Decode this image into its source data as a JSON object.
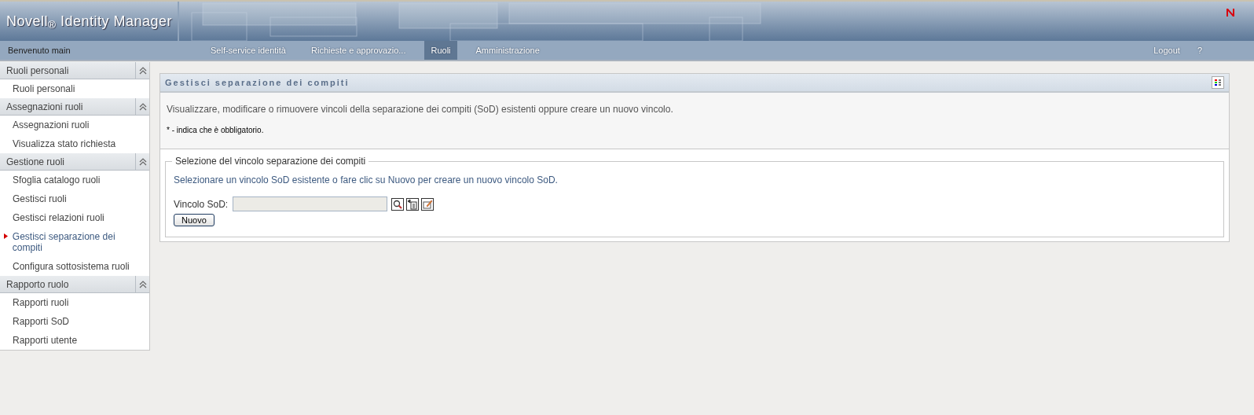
{
  "header": {
    "title": "Novell$_{®}$ Identity Manager"
  },
  "nav": {
    "welcome": "Benvenuto main",
    "tabs": [
      {
        "label": "Self-service identità",
        "selected": false
      },
      {
        "label": "Richieste e approvazio...",
        "selected": false
      },
      {
        "label": "Ruoli",
        "selected": true
      },
      {
        "label": "Amministrazione",
        "selected": false
      }
    ],
    "links": [
      "Logout",
      "?"
    ]
  },
  "sidebar": {
    "sections": [
      {
        "title": "Ruoli personali",
        "expanded": true,
        "items": [
          {
            "label": "Ruoli personali",
            "selected": false
          }
        ]
      },
      {
        "title": "Assegnazioni ruoli",
        "expanded": true,
        "items": [
          {
            "label": "Assegnazioni ruoli",
            "selected": false
          },
          {
            "label": "Visualizza stato richiesta",
            "selected": false
          }
        ]
      },
      {
        "title": "Gestione ruoli",
        "expanded": true,
        "items": [
          {
            "label": "Sfoglia catalogo ruoli",
            "selected": false
          },
          {
            "label": "Gestisci ruoli",
            "selected": false
          },
          {
            "label": "Gestisci relazioni ruoli",
            "selected": false
          },
          {
            "label": "Gestisci separazione dei compiti",
            "selected": true
          },
          {
            "label": "Configura sottosistema ruoli",
            "selected": false
          }
        ]
      },
      {
        "title": "Rapporto ruolo",
        "expanded": true,
        "items": [
          {
            "label": "Rapporti ruoli",
            "selected": false
          },
          {
            "label": "Rapporti SoD",
            "selected": false
          },
          {
            "label": "Rapporti utente",
            "selected": false
          }
        ]
      }
    ]
  },
  "panel": {
    "title": "Gestisci separazione dei compiti",
    "description": "Visualizzare, modificare o rimuovere vincoli della separazione dei compiti (SoD) esistenti oppure creare un nuovo vincolo.",
    "required_note": "* - indica che è obbligatorio.",
    "fieldset": {
      "legend": "Selezione del vincolo separazione dei compiti",
      "hint": "Selezionare un vincolo SoD esistente o fare clic su Nuovo per creare un nuovo vincolo SoD.",
      "field_label": "Vincolo SoD:",
      "button": "Nuovo"
    }
  }
}
